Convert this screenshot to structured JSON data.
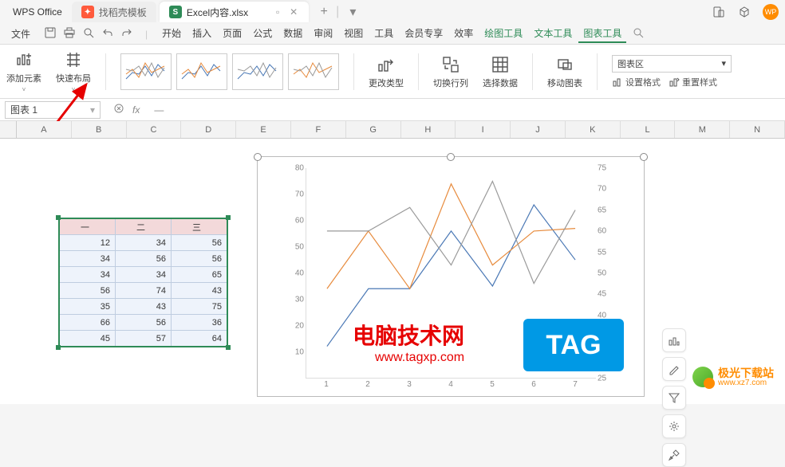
{
  "app_name": "WPS Office",
  "tabs": {
    "inactive": {
      "icon_bg": "#ff5a3c",
      "label": "找稻壳模板"
    },
    "active": {
      "icon_bg": "#2e8b57",
      "icon_letter": "S",
      "label": "Excel内容.xlsx"
    }
  },
  "menubar": {
    "file": "文件",
    "items": [
      "开始",
      "插入",
      "页面",
      "公式",
      "数据",
      "审阅",
      "视图",
      "工具",
      "会员专享",
      "效率"
    ],
    "chart_tools": [
      "绘图工具",
      "文本工具",
      "图表工具"
    ]
  },
  "ribbon": {
    "add_element": "添加元素",
    "quick_layout": "快速布局",
    "change_type": "更改类型",
    "switch_rc": "切换行列",
    "select_data": "选择数据",
    "move_chart": "移动图表",
    "chart_area": "图表区",
    "set_format": "设置格式",
    "reset_style": "重置样式"
  },
  "formula_bar": {
    "name_box": "图表 1",
    "value": "—"
  },
  "columns": [
    "A",
    "B",
    "C",
    "D",
    "E",
    "F",
    "G",
    "H",
    "I",
    "J",
    "K",
    "L",
    "M",
    "N"
  ],
  "table": {
    "headers": [
      "一",
      "二",
      "三"
    ],
    "rows": [
      [
        12,
        34,
        56
      ],
      [
        34,
        56,
        56
      ],
      [
        34,
        34,
        65
      ],
      [
        56,
        74,
        43
      ],
      [
        35,
        43,
        75
      ],
      [
        66,
        56,
        36
      ],
      [
        45,
        57,
        64
      ]
    ]
  },
  "chart_data": {
    "type": "line",
    "categories": [
      1,
      2,
      3,
      4,
      5,
      6,
      7
    ],
    "series": [
      {
        "name": "一",
        "color": "#4a78b5",
        "values": [
          12,
          34,
          34,
          56,
          35,
          66,
          45
        ]
      },
      {
        "name": "二",
        "color": "#e78b3d",
        "values": [
          34,
          56,
          34,
          74,
          43,
          56,
          57
        ]
      },
      {
        "name": "三",
        "color": "#9a9a9a",
        "values": [
          56,
          56,
          65,
          43,
          75,
          36,
          64
        ]
      }
    ],
    "ylabel": "",
    "xlabel": "",
    "ylim": [
      0,
      80
    ],
    "y_ticks": [
      10,
      20,
      30,
      40,
      50,
      60,
      70,
      80
    ],
    "y2_ticks": [
      25,
      30,
      35,
      40,
      45,
      50,
      55,
      60,
      65,
      70,
      75
    ],
    "secondary_axis": true
  },
  "watermarks": {
    "dn_title": "电脑技术网",
    "dn_url": "www.tagxp.com",
    "tag": "TAG",
    "jgxz": "极光下载站",
    "jgxz_url": "www.xz7.com"
  }
}
